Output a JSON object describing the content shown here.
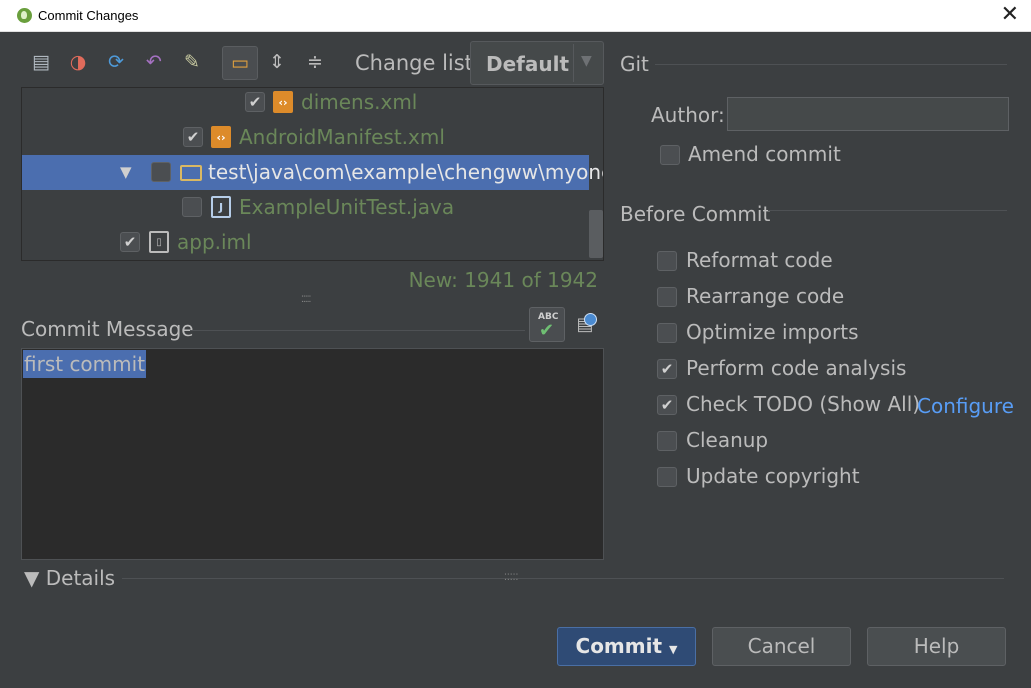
{
  "window": {
    "title": "Commit Changes",
    "close_glyph": "✕"
  },
  "toolbar": {
    "icons": [
      "show-diff-icon",
      "move-to-changelist-icon",
      "refresh-icon",
      "rollback-icon",
      "edit-source-icon",
      "group-by-directory-icon",
      "expand-all-icon",
      "collapse-all-icon"
    ],
    "changelist_label": "Change list:",
    "changelist_value": "Default"
  },
  "tree": {
    "rows": [
      {
        "label": "dimens.xml",
        "checked": true
      },
      {
        "label": "AndroidManifest.xml",
        "checked": true
      },
      {
        "label": "test\\java\\com\\example\\chengww\\myone",
        "checked": false,
        "selected": true
      },
      {
        "label": "ExampleUnitTest.java",
        "checked": false
      },
      {
        "label": "app.iml",
        "checked": true
      }
    ],
    "status": "New: 1941 of 1942"
  },
  "commit_message": {
    "label": "Commit Message",
    "text": "first commit",
    "spellcheck_label": "ABC"
  },
  "details": {
    "label": "Details"
  },
  "git": {
    "section_label": "Git",
    "author_label": "Author:",
    "author_value": "",
    "amend_label": "Amend commit",
    "amend_checked": false
  },
  "before_commit": {
    "section_label": "Before Commit",
    "options": [
      {
        "label": "Reformat code",
        "checked": false
      },
      {
        "label": "Rearrange code",
        "checked": false
      },
      {
        "label": "Optimize imports",
        "checked": false
      },
      {
        "label": "Perform code analysis",
        "checked": true
      },
      {
        "label": "Check TODO (Show All)",
        "checked": true
      },
      {
        "label": "Cleanup",
        "checked": false
      },
      {
        "label": "Update copyright",
        "checked": false
      }
    ],
    "configure_link": "Configure"
  },
  "buttons": {
    "commit": "Commit",
    "cancel": "Cancel",
    "help": "Help"
  }
}
